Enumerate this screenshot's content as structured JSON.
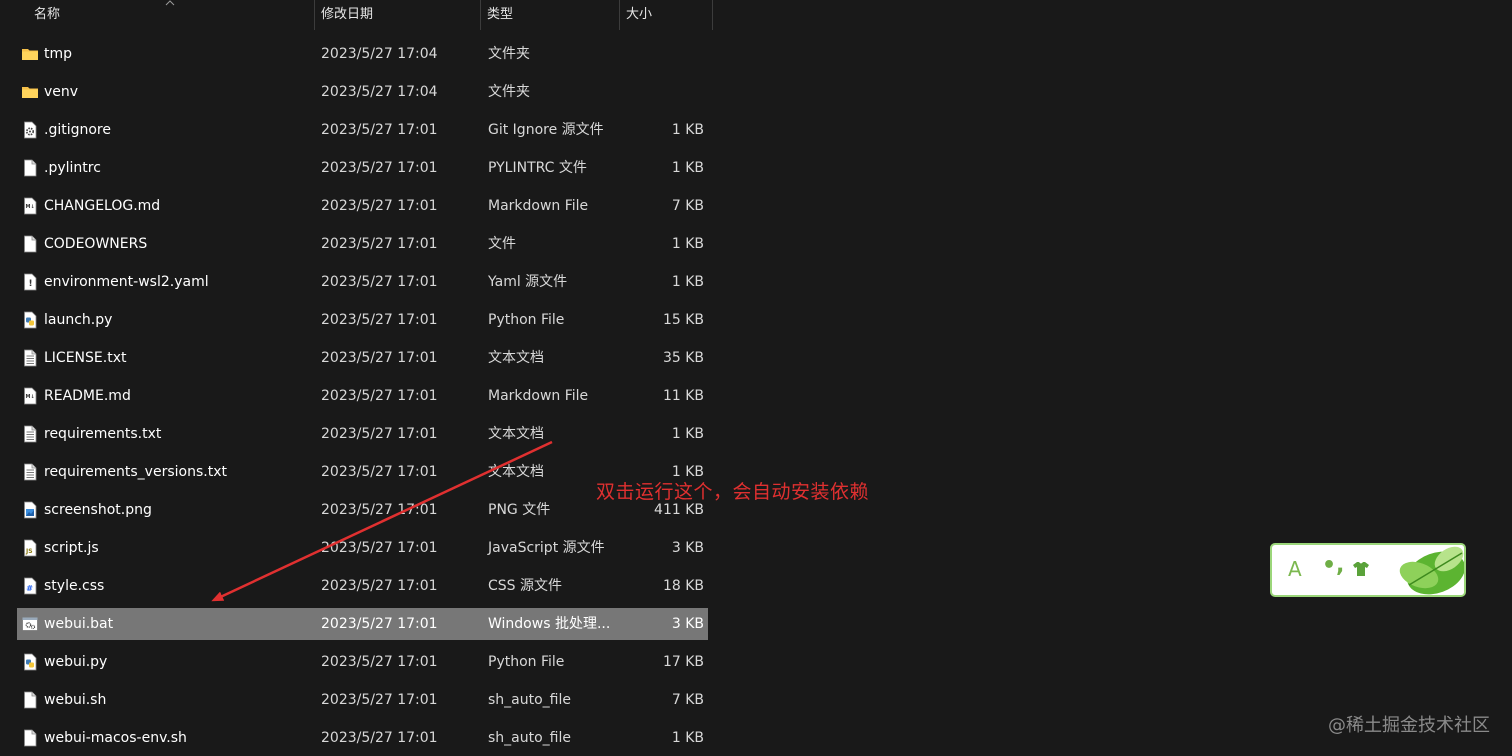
{
  "header": {
    "col_name": "名称",
    "col_date": "修改日期",
    "col_type": "类型",
    "col_size": "大小"
  },
  "files": [
    {
      "name": "tmp",
      "date": "2023/5/27 17:04",
      "type": "文件夹",
      "size": "",
      "icon": "folder-icon"
    },
    {
      "name": "venv",
      "date": "2023/5/27 17:04",
      "type": "文件夹",
      "size": "",
      "icon": "folder-icon"
    },
    {
      "name": ".gitignore",
      "date": "2023/5/27 17:01",
      "type": "Git Ignore 源文件",
      "size": "1 KB",
      "icon": "gear-file-icon"
    },
    {
      "name": ".pylintrc",
      "date": "2023/5/27 17:01",
      "type": "PYLINTRC 文件",
      "size": "1 KB",
      "icon": "blank-file-icon"
    },
    {
      "name": "CHANGELOG.md",
      "date": "2023/5/27 17:01",
      "type": "Markdown File",
      "size": "7 KB",
      "icon": "markdown-file-icon"
    },
    {
      "name": "CODEOWNERS",
      "date": "2023/5/27 17:01",
      "type": "文件",
      "size": "1 KB",
      "icon": "blank-file-icon"
    },
    {
      "name": "environment-wsl2.yaml",
      "date": "2023/5/27 17:01",
      "type": "Yaml 源文件",
      "size": "1 KB",
      "icon": "yaml-file-icon"
    },
    {
      "name": "launch.py",
      "date": "2023/5/27 17:01",
      "type": "Python File",
      "size": "15 KB",
      "icon": "python-file-icon"
    },
    {
      "name": "LICENSE.txt",
      "date": "2023/5/27 17:01",
      "type": "文本文档",
      "size": "35 KB",
      "icon": "text-file-icon"
    },
    {
      "name": "README.md",
      "date": "2023/5/27 17:01",
      "type": "Markdown File",
      "size": "11 KB",
      "icon": "markdown-file-icon"
    },
    {
      "name": "requirements.txt",
      "date": "2023/5/27 17:01",
      "type": "文本文档",
      "size": "1 KB",
      "icon": "text-file-icon"
    },
    {
      "name": "requirements_versions.txt",
      "date": "2023/5/27 17:01",
      "type": "文本文档",
      "size": "1 KB",
      "icon": "text-file-icon"
    },
    {
      "name": "screenshot.png",
      "date": "2023/5/27 17:01",
      "type": "PNG 文件",
      "size": "411 KB",
      "icon": "image-file-icon"
    },
    {
      "name": "script.js",
      "date": "2023/5/27 17:01",
      "type": "JavaScript 源文件",
      "size": "3 KB",
      "icon": "js-file-icon"
    },
    {
      "name": "style.css",
      "date": "2023/5/27 17:01",
      "type": "CSS 源文件",
      "size": "18 KB",
      "icon": "css-file-icon"
    },
    {
      "name": "webui.bat",
      "date": "2023/5/27 17:01",
      "type": "Windows 批处理...",
      "size": "3 KB",
      "icon": "batch-file-icon",
      "selected": true
    },
    {
      "name": "webui.py",
      "date": "2023/5/27 17:01",
      "type": "Python File",
      "size": "17 KB",
      "icon": "python-file-icon"
    },
    {
      "name": "webui.sh",
      "date": "2023/5/27 17:01",
      "type": "sh_auto_file",
      "size": "7 KB",
      "icon": "blank-file-icon"
    },
    {
      "name": "webui-macos-env.sh",
      "date": "2023/5/27 17:01",
      "type": "sh_auto_file",
      "size": "1 KB",
      "icon": "blank-file-icon"
    }
  ],
  "annotation": {
    "text": "双击运行这个，会自动安装依赖",
    "color": "#e03030"
  },
  "ime": {
    "mode_glyph": "A",
    "punct_glyph": "•,"
  },
  "watermark": "@稀土掘金技术社区",
  "colors": {
    "background": "#191919",
    "selection": "#777777",
    "folder": "#f5c04a",
    "arrow": "#e03030"
  }
}
